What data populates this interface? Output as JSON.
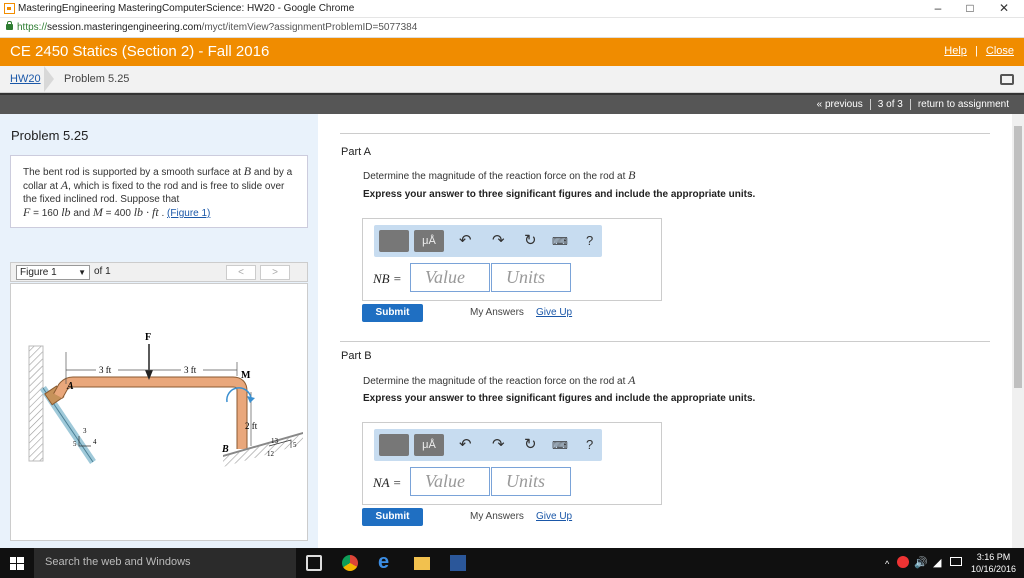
{
  "browser": {
    "title": "MasteringEngineering MasteringComputerScience: HW20 - Google Chrome",
    "url_scheme": "https://",
    "url_host": "session.masteringengineering.com",
    "url_path": "/myct/itemView?assignmentProblemID=5077384",
    "minimize": "–",
    "maximize": "□",
    "close": "✕"
  },
  "course": {
    "title": "CE 2450 Statics (Section 2) - Fall 2016",
    "help": "Help",
    "sep": "|",
    "close": "Close"
  },
  "breadcrumb": {
    "assignment": "HW20",
    "problem": "Problem 5.25"
  },
  "nav": {
    "previous": "« previous",
    "position": "3 of 3",
    "return": "return to assignment"
  },
  "problem": {
    "heading": "Problem 5.25",
    "statement_1": "The bent rod is supported by a smooth surface at",
    "B": "B",
    "statement_2": "and by a collar at",
    "A": "A",
    "statement_3": ", which is fixed to the rod and is free to slide over the fixed inclined rod. Suppose that",
    "F": "F",
    "F_val": "= 160",
    "F_unit": "lb",
    "and": "and",
    "M": "M",
    "M_val": "= 400",
    "M_unit": "lb · ft",
    "dot": ".",
    "figure_link": "(Figure 1)"
  },
  "figure_nav": {
    "selected": "Figure 1",
    "of": "of 1",
    "prev": "<",
    "next": ">"
  },
  "figure": {
    "F": "F",
    "M": "M",
    "A": "A",
    "B": "B",
    "d1": "3 ft",
    "d2": "3 ft",
    "d3": "2 ft",
    "s3": "3",
    "s4": "4",
    "s5": "5",
    "t13": "13",
    "t12": "12",
    "t5": "5"
  },
  "partA": {
    "heading": "Part A",
    "question": "Determine the magnitude of the reaction force on the rod at",
    "point": "B",
    "instruction": "Express your answer to three significant figures and include the appropriate units.",
    "var": "NB =",
    "value_placeholder": "Value",
    "units_placeholder": "Units",
    "submit": "Submit",
    "my_answers": "My Answers",
    "give_up": "Give Up"
  },
  "partB": {
    "heading": "Part B",
    "question": "Determine the magnitude of the reaction force on the rod at",
    "point": "A",
    "instruction": "Express your answer to three significant figures and include the appropriate units.",
    "var": "NA =",
    "value_placeholder": "Value",
    "units_placeholder": "Units",
    "submit": "Submit",
    "my_answers": "My Answers",
    "give_up": "Give Up"
  },
  "toolbar": {
    "mu": "μÅ",
    "help": "?"
  },
  "taskbar": {
    "search": "Search the web and Windows",
    "time": "3:16 PM",
    "date": "10/16/2016"
  },
  "colors": {
    "accent": "#f08c00",
    "link": "#1a57a8",
    "submit": "#1f6fc2",
    "rod": "#e9a77b"
  }
}
